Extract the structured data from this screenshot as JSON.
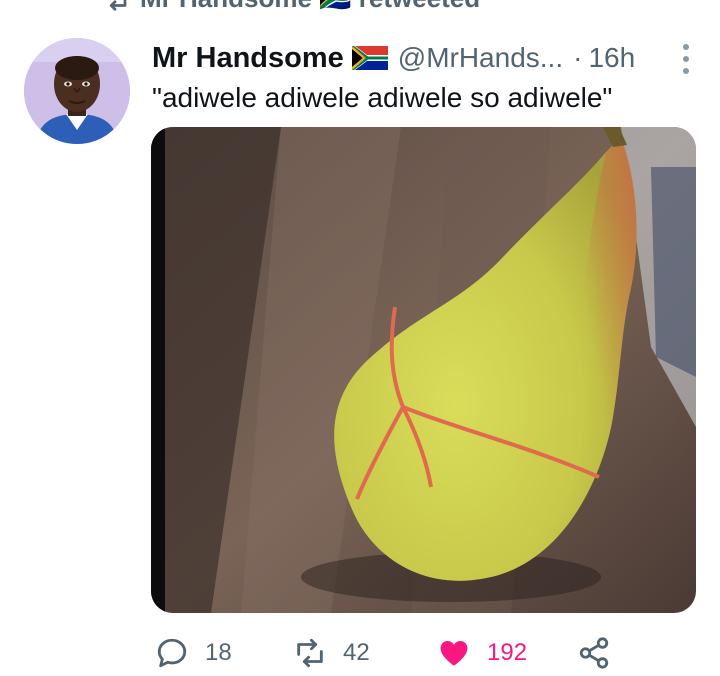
{
  "retweet_context": {
    "label": "Mr Handsome 🇿🇦 retweeted"
  },
  "tweet": {
    "author_name": "Mr Handsome",
    "author_handle": "@MrHands...",
    "separator": "·",
    "time_ago": "16h",
    "text": "\"adiwele adiwele adiwele so adiwele\""
  },
  "actions": {
    "reply_count": "18",
    "retweet_count": "42",
    "like_count": "192"
  },
  "icons": [
    "retweet-icon",
    "flag-icon",
    "more-icon",
    "reply-icon",
    "like-icon",
    "share-icon"
  ],
  "colors": {
    "like": "#f91880",
    "muted": "#536471",
    "text": "#0f1419"
  }
}
